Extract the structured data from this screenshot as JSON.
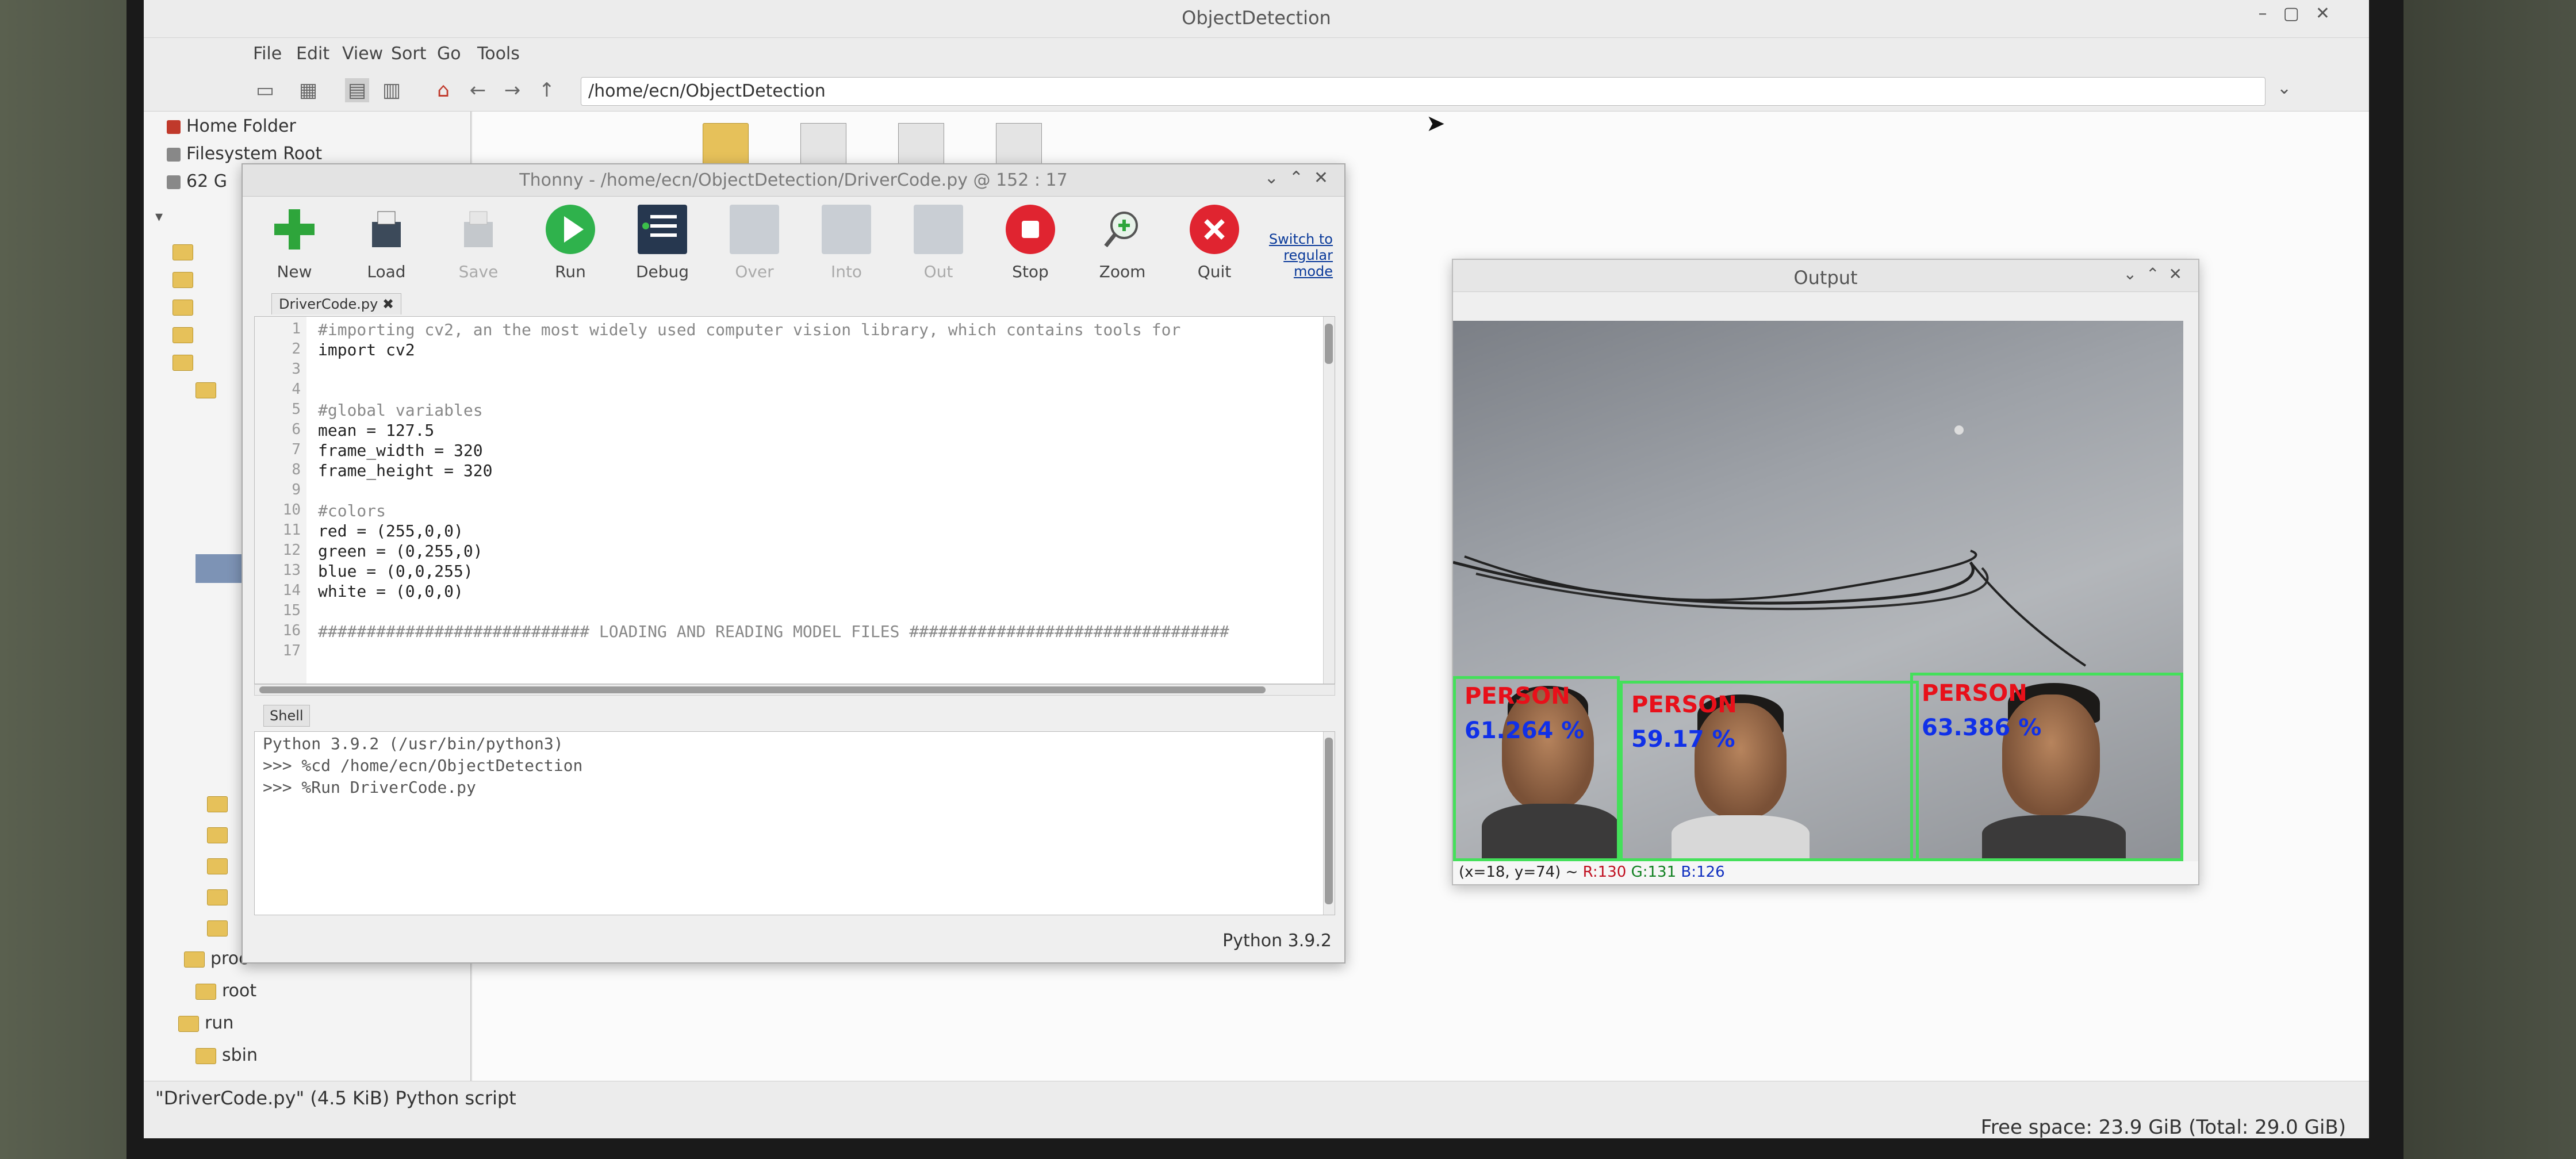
{
  "file_manager": {
    "title": "ObjectDetection",
    "menu": [
      "File",
      "Edit",
      "View",
      "Sort",
      "Go",
      "Tools"
    ],
    "path": "/home/ecn/ObjectDetection",
    "sidebar": {
      "places": [
        "Home Folder",
        "Filesystem Root",
        "62 G"
      ],
      "folders": [
        "proc",
        "root",
        "run",
        "sbin"
      ]
    },
    "status_left": "\"DriverCode.py\" (4.5 KiB) Python script",
    "status_right": "Free space: 23.9 GiB (Total: 29.0 GiB)"
  },
  "thonny": {
    "title": "Thonny - /home/ecn/ObjectDetection/DriverCode.py @ 152 : 17",
    "toolbar": [
      {
        "label": "New",
        "icon": "new-file-icon",
        "enabled": true
      },
      {
        "label": "Load",
        "icon": "load-icon",
        "enabled": true
      },
      {
        "label": "Save",
        "icon": "save-icon",
        "enabled": false
      },
      {
        "label": "Run",
        "icon": "run-icon",
        "enabled": true
      },
      {
        "label": "Debug",
        "icon": "debug-icon",
        "enabled": true
      },
      {
        "label": "Over",
        "icon": "step-over-icon",
        "enabled": false
      },
      {
        "label": "Into",
        "icon": "step-into-icon",
        "enabled": false
      },
      {
        "label": "Out",
        "icon": "step-out-icon",
        "enabled": false
      },
      {
        "label": "Stop",
        "icon": "stop-icon",
        "enabled": true
      },
      {
        "label": "Zoom",
        "icon": "zoom-icon",
        "enabled": true
      },
      {
        "label": "Quit",
        "icon": "quit-icon",
        "enabled": true
      }
    ],
    "switch_mode": "Switch to regular mode",
    "tab": "DriverCode.py",
    "code_lines": [
      "#importing cv2, an the most widely used computer vision library, which contains tools for",
      "import cv2",
      "",
      "",
      "#global variables",
      "mean = 127.5",
      "frame_width = 320",
      "frame_height = 320",
      "",
      "#colors",
      "red = (255,0,0)",
      "green = (0,255,0)",
      "blue = (0,0,255)",
      "white = (0,0,0)",
      "",
      "############################ LOADING AND READING MODEL FILES #################################",
      ""
    ],
    "shell_tab": "Shell",
    "shell_lines": [
      "Python 3.9.2 (/usr/bin/python3)",
      ">>> %cd /home/ecn/ObjectDetection",
      ">>> %Run DriverCode.py"
    ],
    "status": "Python 3.9.2"
  },
  "output_window": {
    "title": "Output",
    "detections": [
      {
        "label": "PERSON",
        "confidence": "61.264 %"
      },
      {
        "label": "PERSON",
        "confidence": "59.17 %"
      },
      {
        "label": "PERSON",
        "confidence": "63.386 %"
      }
    ],
    "pixel_info": "(x=18, y=74) ~ R:130 G:131 B:126"
  },
  "colors": {
    "detection_box": "#44e05a",
    "detection_label": "#e8101a",
    "detection_confidence": "#1030e8"
  }
}
